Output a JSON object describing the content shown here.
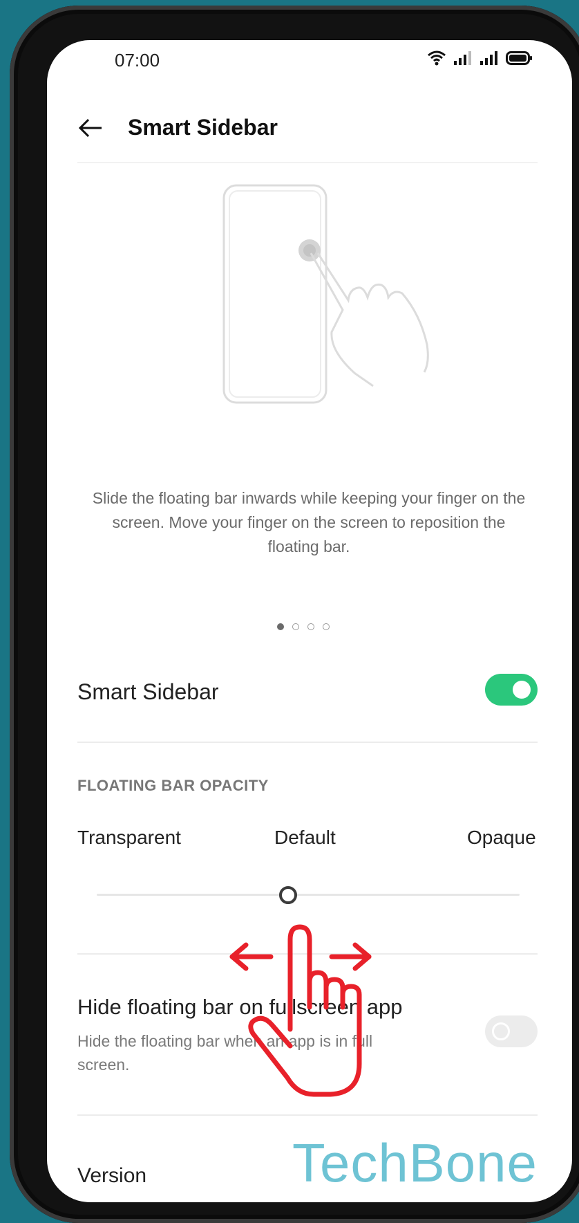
{
  "status_bar": {
    "time": "07:00",
    "icons": [
      "wifi-icon",
      "signal-icon",
      "signal-icon",
      "battery-icon"
    ]
  },
  "header": {
    "title": "Smart Sidebar",
    "back_icon": "arrow-left-icon"
  },
  "tutorial": {
    "description": "Slide the floating bar inwards while keeping your finger on the screen. Move your finger on the screen to reposition the floating bar.",
    "page_count": 4,
    "current_page": 1
  },
  "smart_sidebar": {
    "label": "Smart Sidebar",
    "enabled": true
  },
  "opacity": {
    "section_title": "FLOATING BAR OPACITY",
    "labels": {
      "left": "Transparent",
      "center": "Default",
      "right": "Opaque"
    },
    "value_fraction": 0.5
  },
  "hide_fullscreen": {
    "title": "Hide floating bar on fullscreen app",
    "subtitle": "Hide the floating bar when an app is in full screen.",
    "enabled": false
  },
  "version": {
    "label": "Version"
  },
  "watermark": {
    "text": "TechBone"
  },
  "colors": {
    "accent": "#2bc77c",
    "gesture": "#e8212a",
    "watermark": "#6ec3d4",
    "background": "#1a7585"
  }
}
